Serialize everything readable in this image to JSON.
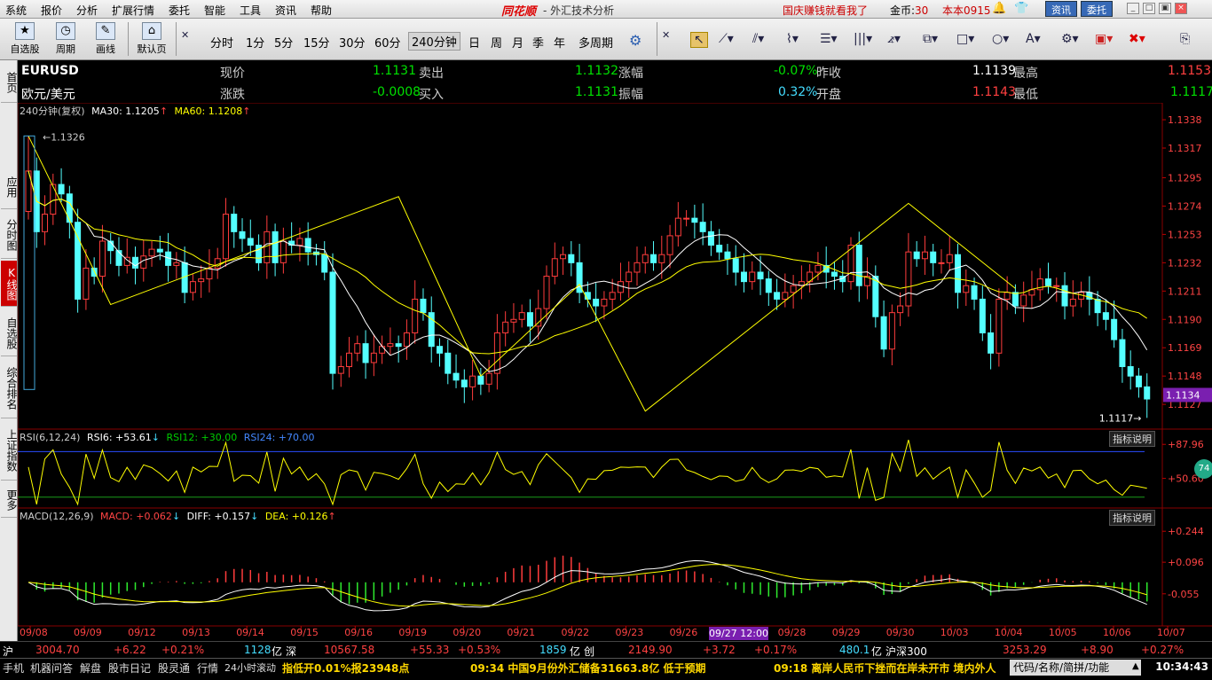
{
  "menu": {
    "items": [
      "系统",
      "报价",
      "分析",
      "扩展行情",
      "委托",
      "智能",
      "工具",
      "资讯",
      "帮助"
    ],
    "logo": "同花顺",
    "subtitle": "- 外汇技术分析",
    "promo": "国庆赚钱就看我了",
    "coin_label": "金币:",
    "coin_value": "30",
    "version": "本本0915",
    "news_btn": "资讯",
    "trade_btn": "委托"
  },
  "toolbar": {
    "big": [
      "自选股",
      "周期",
      "画线",
      "默认页"
    ],
    "periods": [
      "分时",
      "1分",
      "5分",
      "15分",
      "30分",
      "60分",
      "240分钟",
      "日",
      "周",
      "月",
      "季",
      "年",
      "多周期"
    ],
    "selected_period": "240分钟"
  },
  "left_tabs": [
    "首页",
    "应用",
    "分时图",
    "K线图",
    "自选股",
    "综合排名",
    "上证指数",
    "更多"
  ],
  "quote": {
    "symbol": "EURUSD",
    "name": "欧元/美元",
    "rows": [
      [
        {
          "l": "现价",
          "v": "1.1131",
          "c": "g"
        },
        {
          "l": "卖出",
          "v": "1.1132",
          "c": "g"
        },
        {
          "l": "涨幅",
          "v": "-0.07%",
          "c": "g"
        },
        {
          "l": "昨收",
          "v": "1.1139",
          "c": "w"
        },
        {
          "l": "最高",
          "v": "1.1153",
          "c": "r"
        }
      ],
      [
        {
          "l": "涨跌",
          "v": "-0.0008",
          "c": "g"
        },
        {
          "l": "买入",
          "v": "1.1131",
          "c": "g"
        },
        {
          "l": "振幅",
          "v": "0.32%",
          "c": "cy"
        },
        {
          "l": "开盘",
          "v": "1.1143",
          "c": "r"
        },
        {
          "l": "最低",
          "v": "1.1117",
          "c": "g"
        }
      ]
    ]
  },
  "main_indicator": {
    "period": "240分钟(复权)",
    "ma30": "MA30: 1.1205",
    "ma60": "MA60: 1.1208"
  },
  "rsi": {
    "title": "RSI(6,12,24)",
    "rsi6": "RSI6: +53.61",
    "rsi12": "RSI12: +30.00",
    "rsi24": "RSI24: +70.00",
    "btn": "指标说明",
    "axis": [
      "+87.96",
      "+50.60"
    ],
    "badge": "74"
  },
  "macd": {
    "title": "MACD(12,26,9)",
    "macd": "MACD: +0.062",
    "diff": "DIFF: +0.157",
    "dea": "DEA: +0.126",
    "btn": "指标说明",
    "axis": [
      "+0.244",
      "+0.096",
      "-0.055"
    ]
  },
  "chart_data": {
    "type": "candlestick",
    "y_ticks": [
      "1.1338",
      "1.1317",
      "1.1295",
      "1.1274",
      "1.1253",
      "1.1232",
      "1.1211",
      "1.1190",
      "1.1169",
      "1.1148",
      "1.1127"
    ],
    "ylim": [
      1.111,
      1.134
    ],
    "x_labels": [
      "09/08",
      "09/09",
      "09/12",
      "09/13",
      "09/14",
      "09/15",
      "09/16",
      "09/19",
      "09/20",
      "09/21",
      "09/22",
      "09/23",
      "09/26",
      "09/27 12:00",
      "09/28",
      "09/29",
      "09/30",
      "10/03",
      "10/04",
      "10/05",
      "10/06",
      "10/07"
    ],
    "high_marker": "1.1326",
    "low_marker": "1.1117",
    "current_price": "1.1134",
    "wave_points": [
      [
        1.1326,
        0
      ],
      [
        1.1201,
        10
      ],
      [
        1.1281,
        45
      ],
      [
        1.1148,
        55
      ],
      [
        1.1216,
        67
      ],
      [
        1.1122,
        75
      ],
      [
        1.1276,
        107
      ],
      [
        1.1213,
        120
      ]
    ],
    "closes": [
      1.13,
      1.1255,
      1.1268,
      1.129,
      1.1283,
      1.1262,
      1.1205,
      1.1228,
      1.1222,
      1.1248,
      1.1241,
      1.123,
      1.1236,
      1.1228,
      1.1237,
      1.1242,
      1.124,
      1.123,
      1.1232,
      1.121,
      1.1218,
      1.122,
      1.1228,
      1.1235,
      1.1268,
      1.1255,
      1.125,
      1.1245,
      1.1232,
      1.1255,
      1.1232,
      1.1248,
      1.1245,
      1.125,
      1.124,
      1.1238,
      1.1225,
      1.115,
      1.1155,
      1.1165,
      1.1172,
      1.1158,
      1.1165,
      1.117,
      1.1172,
      1.117,
      1.118,
      1.1205,
      1.1195,
      1.117,
      1.1165,
      1.115,
      1.1145,
      1.114,
      1.1148,
      1.1142,
      1.115,
      1.118,
      1.1188,
      1.119,
      1.1195,
      1.1185,
      1.1198,
      1.1222,
      1.1235,
      1.1238,
      1.1232,
      1.121,
      1.1205,
      1.12,
      1.1205,
      1.121,
      1.1218,
      1.1225,
      1.1232,
      1.1238,
      1.1232,
      1.1238,
      1.1252,
      1.1265,
      1.1265,
      1.1262,
      1.1255,
      1.1245,
      1.124,
      1.1235,
      1.1225,
      1.1218,
      1.1225,
      1.122,
      1.121,
      1.1205,
      1.121,
      1.1215,
      1.1218,
      1.1225,
      1.123,
      1.1225,
      1.1222,
      1.1218,
      1.1245,
      1.1215,
      1.1222,
      1.1192,
      1.1168,
      1.1195,
      1.12,
      1.124,
      1.1235,
      1.124,
      1.1232,
      1.1232,
      1.1238,
      1.121,
      1.1215,
      1.1205,
      1.118,
      1.1165,
      1.1205,
      1.121,
      1.12,
      1.1208,
      1.1212,
      1.122,
      1.1215,
      1.1215,
      1.12,
      1.1205,
      1.121,
      1.1205,
      1.1195,
      1.119,
      1.1175,
      1.1155,
      1.1148,
      1.114,
      1.1131
    ]
  },
  "status": {
    "sh_label": "沪",
    "sh_value": "3004.70",
    "sh_change": "+6.22",
    "sh_pct": "+0.21%",
    "sh_vol": "1128",
    "yi1": "亿",
    "sz_label": "深",
    "sz_value": "10567.58",
    "sz_change": "+55.33",
    "sz_pct": "+0.53%",
    "cy_vol": "1859",
    "yi2": "亿",
    "cy_label": "创",
    "cy_value": "2149.90",
    "cy_change": "+3.72",
    "cy_pct": "+0.17%",
    "hs_vol": "480.1",
    "yi3": "亿",
    "hs_label": "沪深300",
    "hs_value": "3253.29",
    "hs_change": "+8.90",
    "hs_pct": "+0.27%"
  },
  "taskbar": {
    "items": [
      "手机",
      "机器问答",
      "解盘",
      "股市日记",
      "股灵通",
      "行情",
      "24小时滚动"
    ],
    "news1": "指低开0.01%报23948点",
    "news2": "09:34 中国9月份外汇储备31663.8亿 低于预期",
    "news3": "09:18 离岸人民币下挫而在岸未开市 境内外人",
    "search_placeholder": "代码/名称/简拼/功能",
    "time": "10:34:43"
  }
}
